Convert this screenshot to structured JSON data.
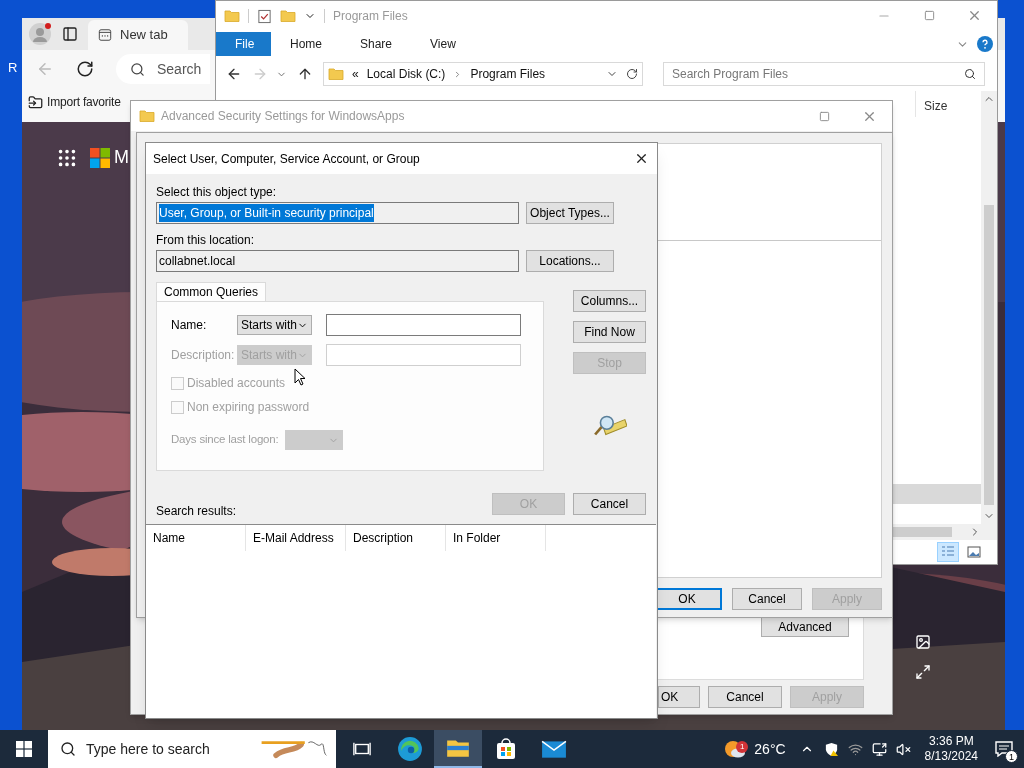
{
  "desktop": {
    "icon_labels": [
      "R"
    ]
  },
  "browser": {
    "tabs": [
      {
        "label": "New tab",
        "selected": true
      }
    ],
    "search_placeholder": "Search",
    "favorites": [
      "Import favorite"
    ],
    "brand_letter": "M"
  },
  "explorer": {
    "title": "Program Files",
    "ribbon_tabs": [
      {
        "label": "File",
        "selected": true
      },
      {
        "label": "Home",
        "selected": false
      },
      {
        "label": "Share",
        "selected": false
      },
      {
        "label": "View",
        "selected": false
      }
    ],
    "path_prefix": "«",
    "path": [
      "Local Disk (C:)",
      "Program Files"
    ],
    "search_placeholder": "Search Program Files",
    "columns": [
      "Size"
    ],
    "views": [
      {
        "kind": "details",
        "selected": true
      },
      {
        "kind": "large_icons",
        "selected": false
      }
    ]
  },
  "security_window": {
    "title": "Advanced Security Settings for WindowsApps",
    "advanced_button": "Advanced",
    "buttons": [
      {
        "label": "OK",
        "disabled": false
      },
      {
        "label": "Cancel",
        "disabled": false
      },
      {
        "label": "Apply",
        "disabled": true
      }
    ]
  },
  "entry_window": {
    "buttons": [
      {
        "label": "OK",
        "disabled": false,
        "default": true
      },
      {
        "label": "Cancel",
        "disabled": false,
        "default": false
      },
      {
        "label": "Apply",
        "disabled": true,
        "default": false
      }
    ]
  },
  "select_dialog": {
    "title": "Select User, Computer, Service Account, or Group",
    "object_type_label": "Select this object type:",
    "object_type": {
      "value": "User, Group, or Built-in security principal",
      "selected": true
    },
    "object_types_button": "Object Types...",
    "location_label": "From this location:",
    "location": "collabnet.local",
    "locations_button": "Locations...",
    "query_tabs": [
      {
        "label": "Common Queries",
        "selected": true
      }
    ],
    "query_rows": [
      {
        "label": "Name:",
        "mode": "Starts with",
        "disabled": false
      },
      {
        "label": "Description:",
        "mode": "Starts with",
        "disabled": true
      }
    ],
    "checkboxes": [
      {
        "label": "Disabled accounts",
        "checked": false,
        "disabled": true
      },
      {
        "label": "Non expiring password",
        "checked": false,
        "disabled": true
      }
    ],
    "days_label": "Days since last logon:",
    "days_disabled": true,
    "side_buttons": [
      {
        "label": "Columns...",
        "disabled": false
      },
      {
        "label": "Find Now",
        "disabled": false
      },
      {
        "label": "Stop",
        "disabled": true
      }
    ],
    "buttons": [
      {
        "label": "OK",
        "disabled": true
      },
      {
        "label": "Cancel",
        "disabled": false
      }
    ],
    "results_label": "Search results:",
    "result_columns": [
      "Name",
      "E-Mail Address",
      "Description",
      "In Folder"
    ]
  },
  "taskbar": {
    "search_placeholder": "Type here to search",
    "apps": [
      {
        "kind": "task_view",
        "selected": false
      },
      {
        "kind": "edge",
        "selected": false
      },
      {
        "kind": "explorer",
        "selected": true
      },
      {
        "kind": "store",
        "selected": false
      },
      {
        "kind": "mail",
        "selected": false
      }
    ],
    "weather": {
      "temperature": "26°C",
      "badge": "1"
    },
    "time": "3:36 PM",
    "date": "8/13/2024",
    "notification_badge": "1"
  }
}
